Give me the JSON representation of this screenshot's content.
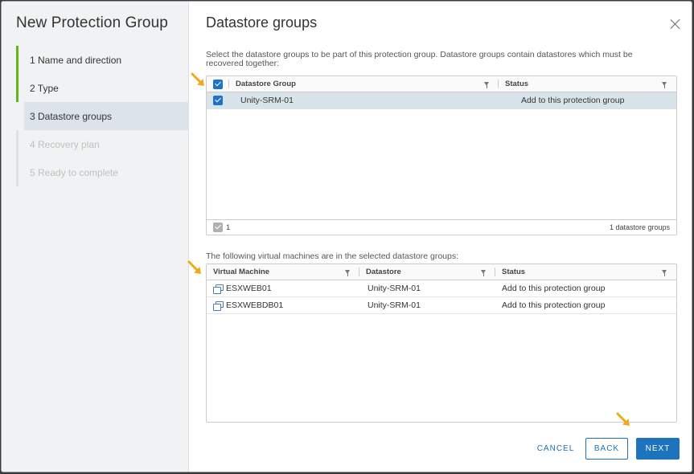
{
  "sidebar": {
    "title": "New Protection Group",
    "steps": [
      {
        "label": "1  Name and direction",
        "state": "done"
      },
      {
        "label": "2  Type",
        "state": "done"
      },
      {
        "label": "3  Datastore groups",
        "state": "active"
      },
      {
        "label": "4  Recovery plan",
        "state": "disabled"
      },
      {
        "label": "5  Ready to complete",
        "state": "disabled"
      }
    ]
  },
  "main": {
    "title": "Datastore groups",
    "description": "Select the datastore groups to be part of this protection group. Datastore groups contain datastores which must be recovered together:",
    "datastore_grid": {
      "columns": [
        "Datastore Group",
        "Status"
      ],
      "rows": [
        {
          "name": "Unity-SRM-01",
          "status": "Add to this protection group",
          "checked": true
        }
      ],
      "footer_selected": "1",
      "footer_total": "1 datastore groups"
    },
    "vm_description": "The following virtual machines are in the selected datastore groups:",
    "vm_grid": {
      "columns": [
        "Virtual Machine",
        "Datastore",
        "Status"
      ],
      "rows": [
        {
          "vm": "ESXWEB01",
          "datastore": "Unity-SRM-01",
          "status": "Add to this protection group"
        },
        {
          "vm": "ESXWEBDB01",
          "datastore": "Unity-SRM-01",
          "status": "Add to this protection group"
        }
      ]
    }
  },
  "buttons": {
    "cancel": "CANCEL",
    "back": "BACK",
    "next": "NEXT"
  },
  "colors": {
    "accent": "#1e73be",
    "step_done": "#61b715",
    "annotation_arrow": "#f0a81c"
  }
}
